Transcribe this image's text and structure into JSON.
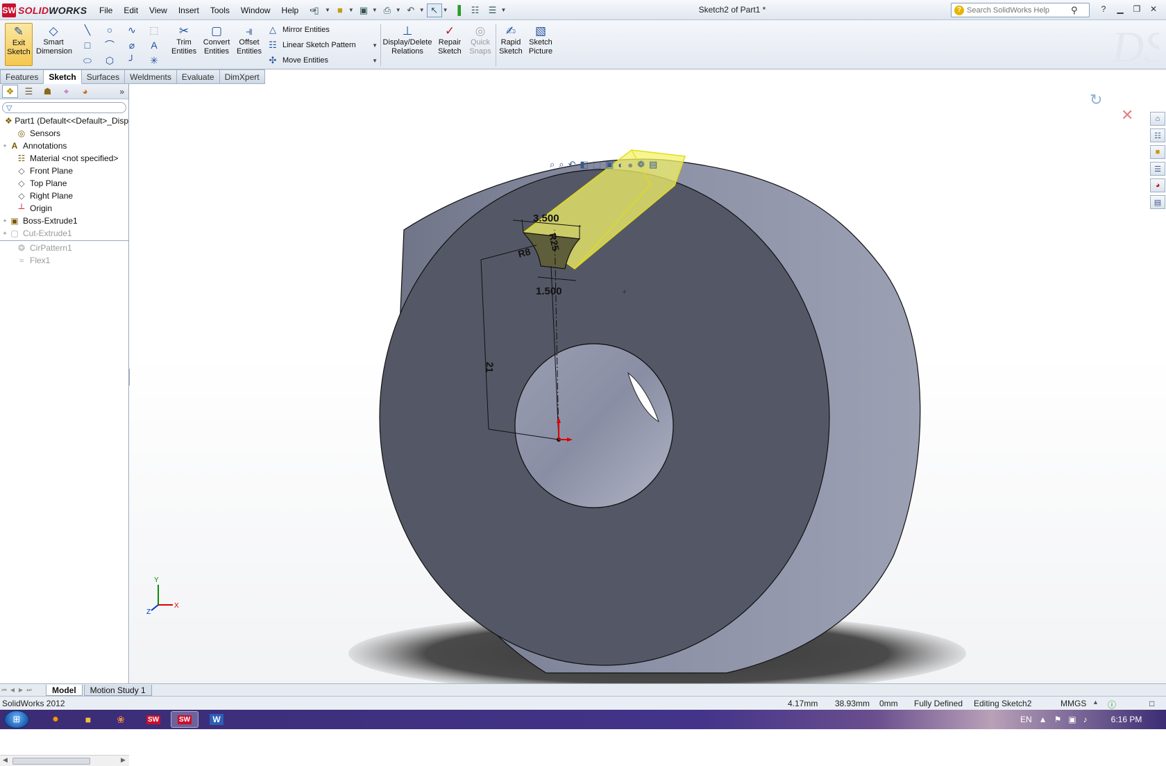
{
  "app": {
    "brand_prefix": "SOLID",
    "brand_suffix": "WORKS",
    "logo_letters": "SW",
    "document_title": "Sketch2 of Part1 *"
  },
  "menu": [
    "File",
    "Edit",
    "View",
    "Insert",
    "Tools",
    "Window",
    "Help"
  ],
  "search": {
    "placeholder": "Search SolidWorks Help"
  },
  "command_manager": {
    "exit_sketch": "Exit Sketch",
    "smart_dimension": "Smart Dimension",
    "trim_entities": "Trim Entities",
    "convert_entities": "Convert Entities",
    "offset_entities": "Offset Entities",
    "mirror_entities": "Mirror Entities",
    "linear_sketch_pattern": "Linear Sketch Pattern",
    "move_entities": "Move Entities",
    "display_delete_relations": "Display/Delete Relations",
    "repair_sketch": "Repair Sketch",
    "quick_snaps": "Quick Snaps",
    "rapid_sketch": "Rapid Sketch",
    "sketch_picture": "Sketch Picture"
  },
  "cmd_tabs": [
    "Features",
    "Sketch",
    "Surfaces",
    "Weldments",
    "Evaluate",
    "DimXpert"
  ],
  "active_cmd_tab": "Sketch",
  "feature_tree": {
    "items": [
      {
        "label": "Part1  (Default<<Default>_Disp",
        "icon": "part-icon",
        "expander": "",
        "state": "normal"
      },
      {
        "label": "Sensors",
        "icon": "sensors-icon",
        "expander": "",
        "state": "normal"
      },
      {
        "label": "Annotations",
        "icon": "annotations-icon",
        "expander": "+",
        "state": "normal"
      },
      {
        "label": "Material <not specified>",
        "icon": "material-icon",
        "expander": "",
        "state": "normal"
      },
      {
        "label": "Front Plane",
        "icon": "plane-icon",
        "expander": "",
        "state": "normal"
      },
      {
        "label": "Top Plane",
        "icon": "plane-icon",
        "expander": "",
        "state": "normal"
      },
      {
        "label": "Right Plane",
        "icon": "plane-icon",
        "expander": "",
        "state": "normal"
      },
      {
        "label": "Origin",
        "icon": "origin-icon",
        "expander": "",
        "state": "normal"
      },
      {
        "label": "Boss-Extrude1",
        "icon": "extrude-icon",
        "expander": "+",
        "state": "normal"
      },
      {
        "label": "Cut-Extrude1",
        "icon": "cut-extrude-icon",
        "expander": "+",
        "state": "rolled-back"
      },
      {
        "label": "CirPattern1",
        "icon": "pattern-icon",
        "expander": "",
        "state": "rolled-back"
      },
      {
        "label": "Flex1",
        "icon": "flex-icon",
        "expander": "",
        "state": "rolled-back"
      }
    ]
  },
  "dimensions": {
    "width_top": "3.500",
    "width_bottom": "1.500",
    "radius_small": "R8",
    "radius_large": "R25",
    "distance": "21"
  },
  "triad": {
    "x": "X",
    "y": "Y",
    "z": "Z"
  },
  "bottom_tabs": [
    "Model",
    "Motion Study 1"
  ],
  "active_bottom_tab": "Model",
  "status": {
    "product": "SolidWorks 2012",
    "x": "4.17mm",
    "y": "38.93mm",
    "z": "0mm",
    "state": "Fully Defined",
    "editing": "Editing Sketch2",
    "units": "MMGS"
  },
  "taskbar": {
    "language": "EN",
    "time": "6:16 PM",
    "apps": [
      "firefox",
      "explorer",
      "paint",
      "solidworks",
      "solidworks-active",
      "word"
    ],
    "word_letter": "W"
  },
  "colors": {
    "model_face": "#545866",
    "model_side": "#8b90a6",
    "sketch_highlight": "#f3f26a",
    "brand_red": "#c8102e"
  }
}
